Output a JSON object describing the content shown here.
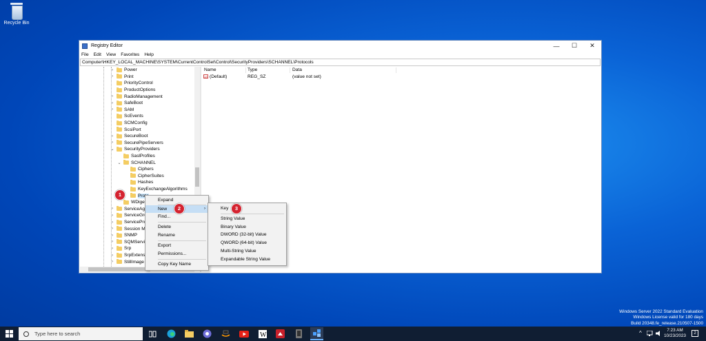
{
  "desktop": {
    "recycle_bin_label": "Recycle Bin"
  },
  "watermark": {
    "line1": "Windows Server 2022 Standard Evaluation",
    "line2": "Windows License valid for 180 days",
    "line3": "Build 20348.fe_release.210507-1500"
  },
  "window": {
    "title": "Registry Editor",
    "controls": {
      "minimize": "—",
      "maximize": "☐",
      "close": "✕"
    },
    "menu": [
      "File",
      "Edit",
      "View",
      "Favorites",
      "Help"
    ],
    "address": "Computer\\HKEY_LOCAL_MACHINE\\SYSTEM\\CurrentControlSet\\Control\\SecurityProviders\\SCHANNEL\\Protocols"
  },
  "tree": {
    "items": [
      {
        "label": "Power",
        "chevron": "›"
      },
      {
        "label": "Print",
        "chevron": "›"
      },
      {
        "label": "PriorityControl",
        "chevron": ""
      },
      {
        "label": "ProductOptions",
        "chevron": ""
      },
      {
        "label": "RadioManagement",
        "chevron": "›"
      },
      {
        "label": "SafeBoot",
        "chevron": "›"
      },
      {
        "label": "SAM",
        "chevron": "›"
      },
      {
        "label": "ScEvents",
        "chevron": ""
      },
      {
        "label": "SCMConfig",
        "chevron": ""
      },
      {
        "label": "ScsiPort",
        "chevron": ""
      },
      {
        "label": "SecureBoot",
        "chevron": "›"
      },
      {
        "label": "SecurePipeServers",
        "chevron": "›"
      },
      {
        "label": "SecurityProviders",
        "chevron": "⌄"
      },
      {
        "label": "SaslProfiles",
        "chevron": ""
      },
      {
        "label": "SCHANNEL",
        "chevron": "⌄"
      },
      {
        "label": "Ciphers",
        "chevron": ""
      },
      {
        "label": "CipherSuites",
        "chevron": ""
      },
      {
        "label": "Hashes",
        "chevron": ""
      },
      {
        "label": "KeyExchangeAlgorithms",
        "chevron": ""
      },
      {
        "label": "Proto",
        "chevron": ""
      },
      {
        "label": "WDiges",
        "chevron": ""
      },
      {
        "label": "ServiceAgg",
        "chevron": "›"
      },
      {
        "label": "ServiceGro",
        "chevron": "›"
      },
      {
        "label": "ServiceProv",
        "chevron": "›"
      },
      {
        "label": "Session Ma",
        "chevron": "›"
      },
      {
        "label": "SNMP",
        "chevron": "›"
      },
      {
        "label": "SQMServic",
        "chevron": "›"
      },
      {
        "label": "Srp",
        "chevron": "›"
      },
      {
        "label": "SrpExtensio",
        "chevron": "›"
      },
      {
        "label": "StillImage",
        "chevron": "›"
      }
    ]
  },
  "list": {
    "columns": [
      "Name",
      "Type",
      "Data"
    ],
    "rows": [
      {
        "name": "(Default)",
        "type": "REG_SZ",
        "data": "(value not set)",
        "icon": "ab"
      }
    ]
  },
  "context_menu": {
    "items": [
      "Expand",
      "New",
      "Find...",
      "Delete",
      "Rename",
      "Export",
      "Permissions...",
      "Copy Key Name"
    ],
    "arrow": "›"
  },
  "submenu": {
    "items": [
      "Key",
      "String Value",
      "Binary Value",
      "DWORD (32-bit) Value",
      "QWORD (64-bit) Value",
      "Multi-String Value",
      "Expandable String Value"
    ]
  },
  "badges": [
    "1",
    "2",
    "3"
  ],
  "taskbar": {
    "search_placeholder": "Type here to search",
    "time": "7:23 AM",
    "date": "10/23/2023",
    "notification_count": "2",
    "tray_chevron": "^"
  }
}
